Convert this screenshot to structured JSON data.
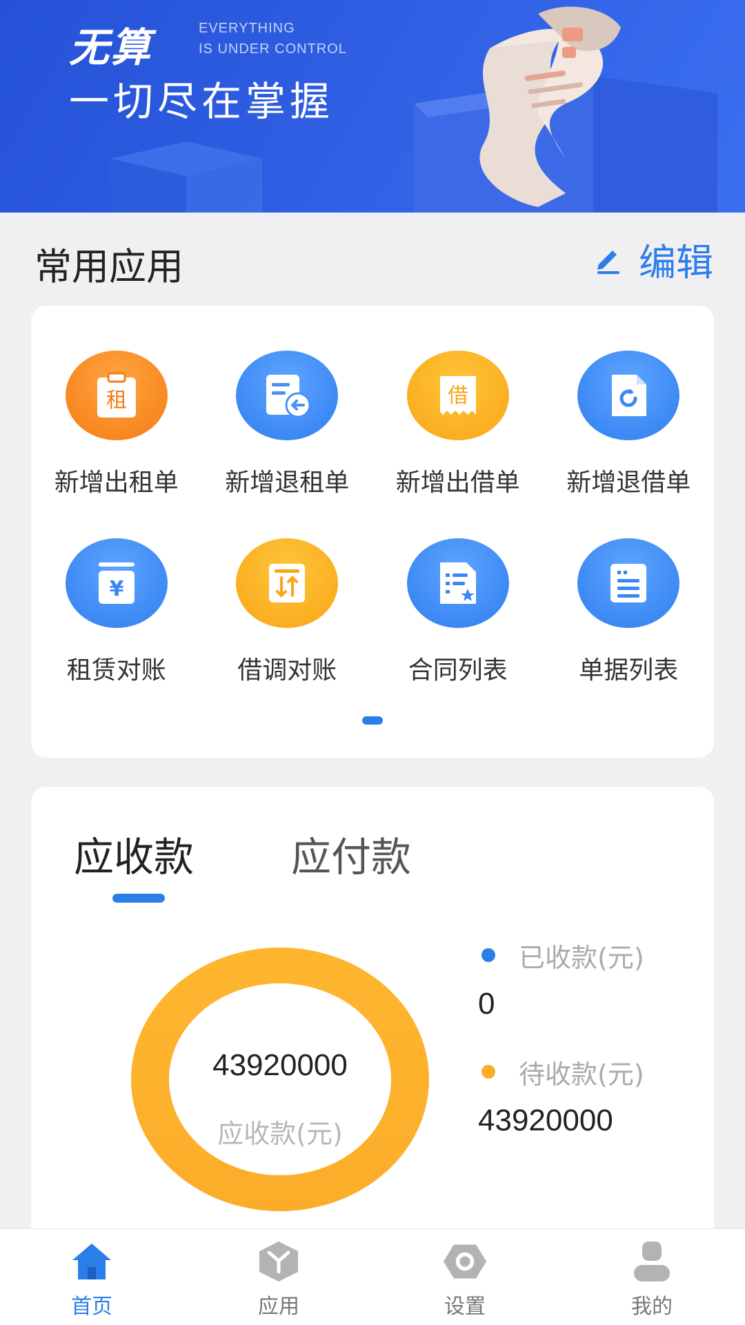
{
  "banner": {
    "brand": "无算",
    "tagline_line1": "EVERYTHING",
    "tagline_line2": "IS UNDER CONTROL",
    "slogan": "一切尽在掌握"
  },
  "section": {
    "title": "常用应用",
    "edit_label": "编辑"
  },
  "apps": [
    {
      "label": "新增出租单",
      "icon": "rent-order-icon",
      "glyph": "租",
      "color": "orange"
    },
    {
      "label": "新增退租单",
      "icon": "return-rent-icon",
      "glyph": "",
      "color": "blue"
    },
    {
      "label": "新增出借单",
      "icon": "lend-order-icon",
      "glyph": "借",
      "color": "gold"
    },
    {
      "label": "新增退借单",
      "icon": "return-lend-icon",
      "glyph": "",
      "color": "blue"
    },
    {
      "label": "租赁对账",
      "icon": "lease-reconcile-icon",
      "glyph": "¥",
      "color": "blue"
    },
    {
      "label": "借调对账",
      "icon": "transfer-reconcile-icon",
      "glyph": "",
      "color": "gold"
    },
    {
      "label": "合同列表",
      "icon": "contract-list-icon",
      "glyph": "",
      "color": "blue"
    },
    {
      "label": "单据列表",
      "icon": "document-list-icon",
      "glyph": "",
      "color": "blue"
    }
  ],
  "finance": {
    "tabs": [
      {
        "label": "应收款",
        "active": true
      },
      {
        "label": "应付款",
        "active": false
      }
    ],
    "total_value": "43920000",
    "total_label": "应收款(元)",
    "legend": [
      {
        "label": "已收款(元)",
        "value": "0",
        "color": "#2b7de9"
      },
      {
        "label": "待收款(元)",
        "value": "43920000",
        "color": "#fbad2a"
      }
    ]
  },
  "chart_data": {
    "type": "pie",
    "categories": [
      "已收款(元)",
      "待收款(元)"
    ],
    "values": [
      0,
      43920000
    ],
    "title": "",
    "center_value": 43920000
  },
  "nav": [
    {
      "label": "首页",
      "icon": "home-icon",
      "active": true
    },
    {
      "label": "应用",
      "icon": "apps-cube-icon",
      "active": false
    },
    {
      "label": "设置",
      "icon": "settings-hex-icon",
      "active": false
    },
    {
      "label": "我的",
      "icon": "profile-icon",
      "active": false
    }
  ],
  "colors": {
    "accent": "#2b7de9",
    "banner": "#2f5ee2",
    "ring": "#fbad2a"
  }
}
